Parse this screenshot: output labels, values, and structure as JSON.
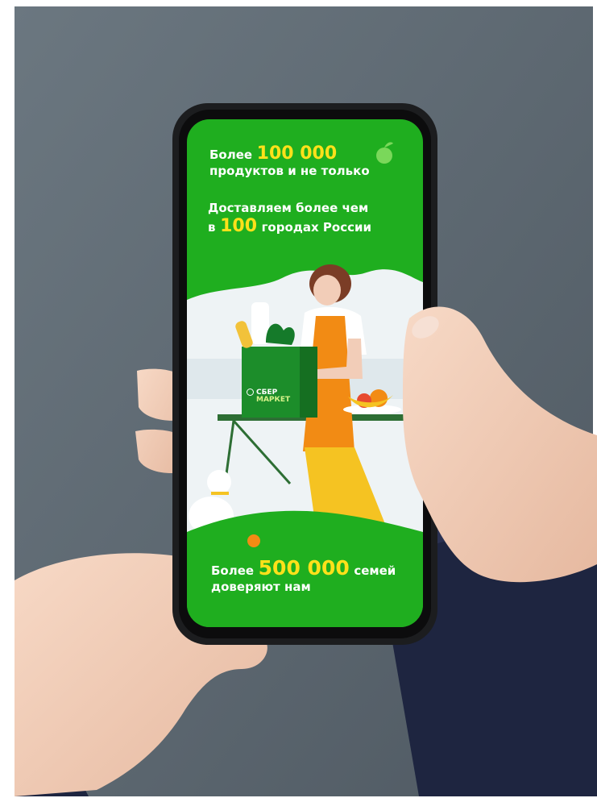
{
  "promo": {
    "line1_prefix": "Более",
    "line1_number": "100 000",
    "line2": "продуктов и не только",
    "line3": "Доставляем более чем",
    "line4_prefix": "в",
    "line4_number": "100",
    "line4_suffix": "городах России",
    "line5_prefix": "Более",
    "line5_number": "500 000",
    "line5_suffix": "семей",
    "line6": "доверяют нам"
  },
  "bag": {
    "brand_top": "СБЕР",
    "brand_bottom": "МАРКЕТ"
  },
  "colors": {
    "screen_green": "#1fae1f",
    "highlight_yellow": "#ffe11a",
    "background_gray": "#5f6a73",
    "skin": "#f2cdb8",
    "sleeve_navy": "#1e2540"
  },
  "icons": {
    "apple_logo": "apple-icon",
    "brand_ring": "check-ring-icon"
  }
}
